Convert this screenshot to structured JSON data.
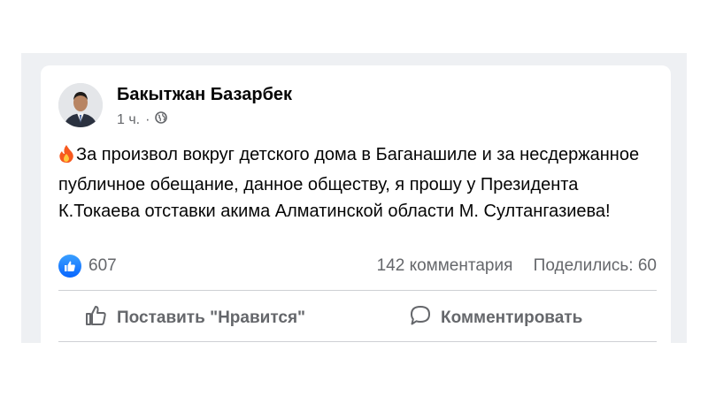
{
  "post": {
    "author": "Бакытжан Базарбек",
    "time": "1 ч.",
    "separator": "·",
    "text": "За произвол вокруг детского дома в Баганашиле и за несдержанное публичное обещание, данное обществу, я прошу у Президента К.Токаева отставки акима Алматинской области М. Султангазиева!"
  },
  "stats": {
    "likes": "607",
    "comments": "142 комментария",
    "shares": "Поделились: 60"
  },
  "actions": {
    "like_label": "Поставить \"Нравится\"",
    "comment_label": "Комментировать"
  },
  "icons": {
    "avatar": "profile-photo",
    "globe": "globe-icon",
    "fire": "fire-emoji-icon",
    "like_reaction": "like-reaction-icon",
    "like": "thumbs-up-icon",
    "comment": "comment-bubble-icon"
  },
  "colors": {
    "like_blue": "#0866ff",
    "text": "#050505",
    "secondary": "#65676b"
  }
}
